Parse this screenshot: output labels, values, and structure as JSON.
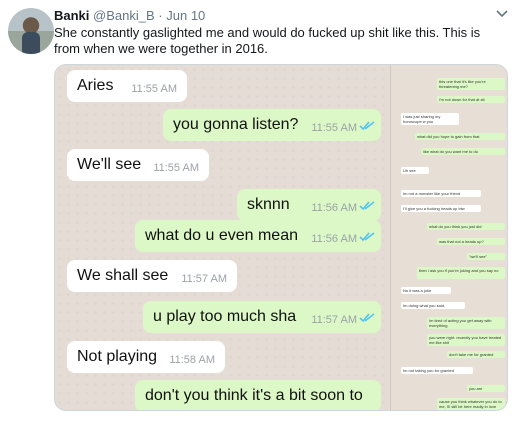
{
  "tweet": {
    "author_name": "Banki",
    "author_handle": "@Banki_B",
    "separator": "·",
    "date": "Jun 10",
    "text": "She constantly gaslighted me and would do fucked up shit like this. This is from when we were together in 2016.",
    "icons": {
      "avatar": "profile-photo",
      "menu": "chevron-down-icon"
    }
  },
  "chat": {
    "colors": {
      "incoming": "#ffffff",
      "outgoing": "#dcf8c6",
      "background": "#e5ddd5",
      "read_ticks": "#4fc3f7"
    },
    "messages": [
      {
        "dir": "in",
        "text": "Aries",
        "time": "11:55 AM"
      },
      {
        "dir": "out",
        "text": "you gonna listen?",
        "time": "11:55 AM",
        "status": "read"
      },
      {
        "dir": "in",
        "text": "We'll see",
        "time": "11:55 AM"
      },
      {
        "dir": "out",
        "text": "sknnn",
        "time": "11:56 AM",
        "status": "read"
      },
      {
        "dir": "out",
        "text": "what do u even mean",
        "time": "11:56 AM",
        "status": "read"
      },
      {
        "dir": "in",
        "text": "We shall see",
        "time": "11:57 AM"
      },
      {
        "dir": "out",
        "text": "u play too much sha",
        "time": "11:57 AM",
        "status": "read"
      },
      {
        "dir": "in",
        "text": "Not playing",
        "time": "11:58 AM"
      },
      {
        "dir": "out",
        "text": "don't you think it's a bit soon to",
        "time": "",
        "status": ""
      }
    ]
  },
  "thumbnail_chat": [
    {
      "dir": "out",
      "text": "this one that it's like you're threatening me?"
    },
    {
      "dir": "out",
      "text": "i'm not down for that at all"
    },
    {
      "dir": "in",
      "text": "I was just sharing my horoscope w you"
    },
    {
      "dir": "out",
      "text": "what did you hope to gain from that"
    },
    {
      "dir": "out",
      "text": "like what do you want me to do"
    },
    {
      "dir": "in",
      "text": "Uh see"
    },
    {
      "dir": "in",
      "text": "Im not a monster like your friend"
    },
    {
      "dir": "in",
      "text": "I'll give you a fucking heads up btw"
    },
    {
      "dir": "out",
      "text": "what do you think you just did"
    },
    {
      "dir": "out",
      "text": "was that not a heads up?"
    },
    {
      "dir": "out",
      "text": "\"we'll see\""
    },
    {
      "dir": "out",
      "text": "then i ask you if you're joking and you say no"
    },
    {
      "dir": "in",
      "text": "No it was a joke"
    },
    {
      "dir": "in",
      "text": "Im doing what you said,"
    },
    {
      "dir": "out",
      "text": "Im tired of acting you get away with everything"
    },
    {
      "dir": "out",
      "text": "you were right. recently you have treated me like shit"
    },
    {
      "dir": "out",
      "text": "don't take me for granted"
    },
    {
      "dir": "in",
      "text": "Im not taking you for granted"
    },
    {
      "dir": "out",
      "text": "you are"
    },
    {
      "dir": "out",
      "text": "cause you think whatever you do to me, i'll still be here madly in love with you"
    }
  ]
}
